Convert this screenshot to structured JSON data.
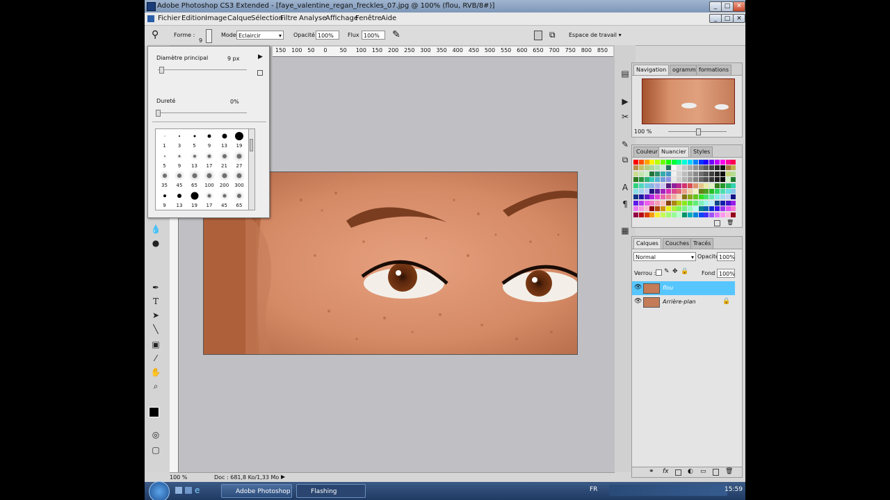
{
  "window": {
    "title": "Adobe Photoshop CS3 Extended - [faye_valentine_regan_freckles_07.jpg @ 100% (flou, RVB/8#)]"
  },
  "menu": [
    "Fichier",
    "Edition",
    "Image",
    "Calque",
    "Sélection",
    "Filtre",
    "Analyse",
    "Affichage",
    "Fenêtre",
    "Aide"
  ],
  "options": {
    "forme_label": "Forme :",
    "forme_value": "9",
    "mode_label": "Mode:",
    "mode_value": "Eclaircir",
    "opacity_label": "Opacité :",
    "opacity_value": "100%",
    "flux_label": "Flux :",
    "flux_value": "100%",
    "workspace": "Espace de travail ▾"
  },
  "ruler_ticks": [
    "150",
    "100",
    "50",
    "0",
    "50",
    "100",
    "150",
    "200",
    "250",
    "300",
    "350",
    "400",
    "450",
    "500",
    "550",
    "600",
    "650",
    "700",
    "750",
    "800",
    "850"
  ],
  "brush_popup": {
    "diameter_label": "Diamètre principal",
    "diameter_value": "9 px",
    "hardness_label": "Dureté",
    "hardness_value": "0%",
    "brushes": [
      {
        "label": "1",
        "size": 1,
        "soft": false
      },
      {
        "label": "3",
        "size": 2,
        "soft": false
      },
      {
        "label": "5",
        "size": 3,
        "soft": false
      },
      {
        "label": "9",
        "size": 5,
        "soft": false
      },
      {
        "label": "13",
        "size": 7,
        "soft": false
      },
      {
        "label": "19",
        "size": 12,
        "soft": false
      },
      {
        "label": "5",
        "size": 2,
        "soft": true
      },
      {
        "label": "9",
        "size": 3,
        "soft": true
      },
      {
        "label": "13",
        "size": 4,
        "soft": true
      },
      {
        "label": "17",
        "size": 5,
        "soft": true
      },
      {
        "label": "21",
        "size": 6,
        "soft": true
      },
      {
        "label": "27",
        "size": 7,
        "soft": true
      },
      {
        "label": "35",
        "size": 6,
        "soft": true
      },
      {
        "label": "45",
        "size": 6,
        "soft": true
      },
      {
        "label": "65",
        "size": 7,
        "soft": true
      },
      {
        "label": "100",
        "size": 7,
        "soft": true
      },
      {
        "label": "200",
        "size": 7,
        "soft": true
      },
      {
        "label": "300",
        "size": 7,
        "soft": true
      },
      {
        "label": "9",
        "size": 4,
        "soft": false
      },
      {
        "label": "13",
        "size": 6,
        "soft": false
      },
      {
        "label": "19",
        "size": 11,
        "soft": false
      },
      {
        "label": "17",
        "size": 5,
        "soft": true
      },
      {
        "label": "45",
        "size": 5,
        "soft": true
      },
      {
        "label": "65",
        "size": 6,
        "soft": true
      }
    ]
  },
  "navigator": {
    "tabs": [
      "Navigation",
      "ogramme",
      "formations"
    ],
    "zoom": "100 %"
  },
  "swatches_panel": {
    "tabs": [
      "Couleur",
      "Nuancier",
      "Styles"
    ]
  },
  "layers_panel": {
    "tabs": [
      "Calques",
      "Couches",
      "Tracés"
    ],
    "blend_mode": "Normal",
    "opacity_label": "Opacité :",
    "opacity_value": "100%",
    "lock_label": "Verrou :",
    "fill_label": "Fond :",
    "fill_value": "100%",
    "layers": [
      {
        "name": "flou",
        "selected": true
      },
      {
        "name": "Arrière-plan",
        "selected": false
      }
    ]
  },
  "status": {
    "zoom": "100 %",
    "doc": "Doc : 681,8 Ko/1,33 Mo"
  },
  "taskbar": {
    "tasks": [
      "Adobe Photoshop C...",
      "Flashing"
    ],
    "lang": "FR",
    "clock": "15:59"
  },
  "colors": {
    "selected_layer": "#57c6ff",
    "taskbar": "#1f3a63"
  }
}
